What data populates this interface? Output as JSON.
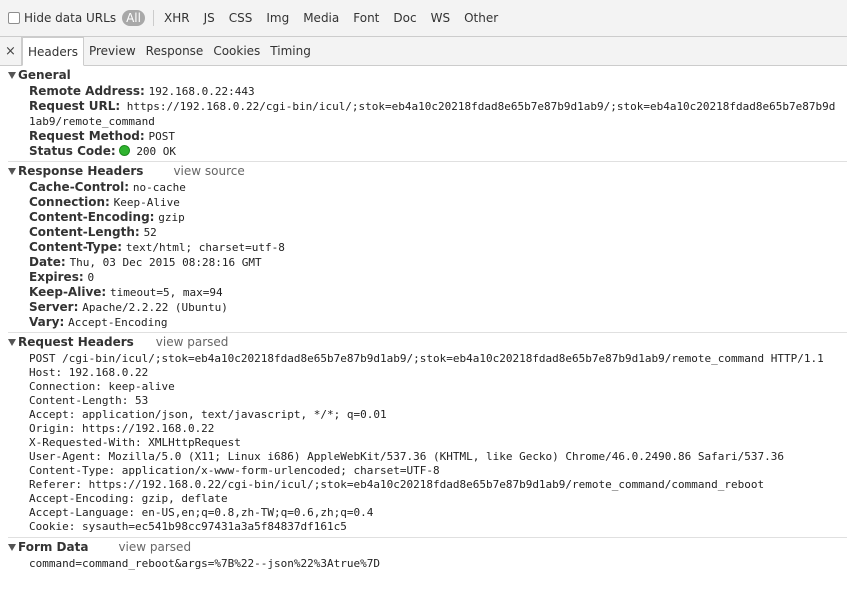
{
  "filter_bar": {
    "hide_data_urls_label": "Hide data URLs",
    "types": [
      {
        "label": "All",
        "active": true
      },
      {
        "label": "XHR",
        "active": false
      },
      {
        "label": "JS",
        "active": false
      },
      {
        "label": "CSS",
        "active": false
      },
      {
        "label": "Img",
        "active": false
      },
      {
        "label": "Media",
        "active": false
      },
      {
        "label": "Font",
        "active": false
      },
      {
        "label": "Doc",
        "active": false
      },
      {
        "label": "WS",
        "active": false
      },
      {
        "label": "Other",
        "active": false
      }
    ]
  },
  "tabs": {
    "close_glyph": "×",
    "items": [
      "Headers",
      "Preview",
      "Response",
      "Cookies",
      "Timing"
    ],
    "active": "Headers"
  },
  "general": {
    "title": "General",
    "remote_address_key": "Remote Address:",
    "remote_address": "192.168.0.22:443",
    "request_url_key": "Request URL:",
    "request_url": "https://192.168.0.22/cgi-bin/icul/;stok=eb4a10c20218fdad8e65b7e87b9d1ab9/;stok=eb4a10c20218fdad8e65b7e87b9d1ab9/remote_command",
    "request_method_key": "Request Method:",
    "request_method": "POST",
    "status_code_key": "Status Code:",
    "status_code": "200 OK",
    "status_color": "#2fb32f"
  },
  "response_headers": {
    "title": "Response Headers",
    "link": "view source",
    "rows": [
      {
        "key": "Cache-Control:",
        "value": "no-cache"
      },
      {
        "key": "Connection:",
        "value": "Keep-Alive"
      },
      {
        "key": "Content-Encoding:",
        "value": "gzip"
      },
      {
        "key": "Content-Length:",
        "value": "52"
      },
      {
        "key": "Content-Type:",
        "value": "text/html; charset=utf-8"
      },
      {
        "key": "Date:",
        "value": "Thu, 03 Dec 2015 08:28:16 GMT"
      },
      {
        "key": "Expires:",
        "value": "0"
      },
      {
        "key": "Keep-Alive:",
        "value": "timeout=5, max=94"
      },
      {
        "key": "Server:",
        "value": "Apache/2.2.22 (Ubuntu)"
      },
      {
        "key": "Vary:",
        "value": "Accept-Encoding"
      }
    ]
  },
  "request_headers": {
    "title": "Request Headers",
    "link": "view parsed",
    "lines": [
      "POST /cgi-bin/icul/;stok=eb4a10c20218fdad8e65b7e87b9d1ab9/;stok=eb4a10c20218fdad8e65b7e87b9d1ab9/remote_command HTTP/1.1",
      "Host: 192.168.0.22",
      "Connection: keep-alive",
      "Content-Length: 53",
      "Accept: application/json, text/javascript, */*; q=0.01",
      "Origin: https://192.168.0.22",
      "X-Requested-With: XMLHttpRequest",
      "User-Agent: Mozilla/5.0 (X11; Linux i686) AppleWebKit/537.36 (KHTML, like Gecko) Chrome/46.0.2490.86 Safari/537.36",
      "Content-Type: application/x-www-form-urlencoded; charset=UTF-8",
      "Referer: https://192.168.0.22/cgi-bin/icul/;stok=eb4a10c20218fdad8e65b7e87b9d1ab9/remote_command/command_reboot",
      "Accept-Encoding: gzip, deflate",
      "Accept-Language: en-US,en;q=0.8,zh-TW;q=0.6,zh;q=0.4",
      "Cookie: sysauth=ec541b98cc97431a3a5f84837df161c5"
    ]
  },
  "form_data": {
    "title": "Form Data",
    "link": "view parsed",
    "lines": [
      "command=command_reboot&args=%7B%22--json%22%3Atrue%7D"
    ]
  }
}
